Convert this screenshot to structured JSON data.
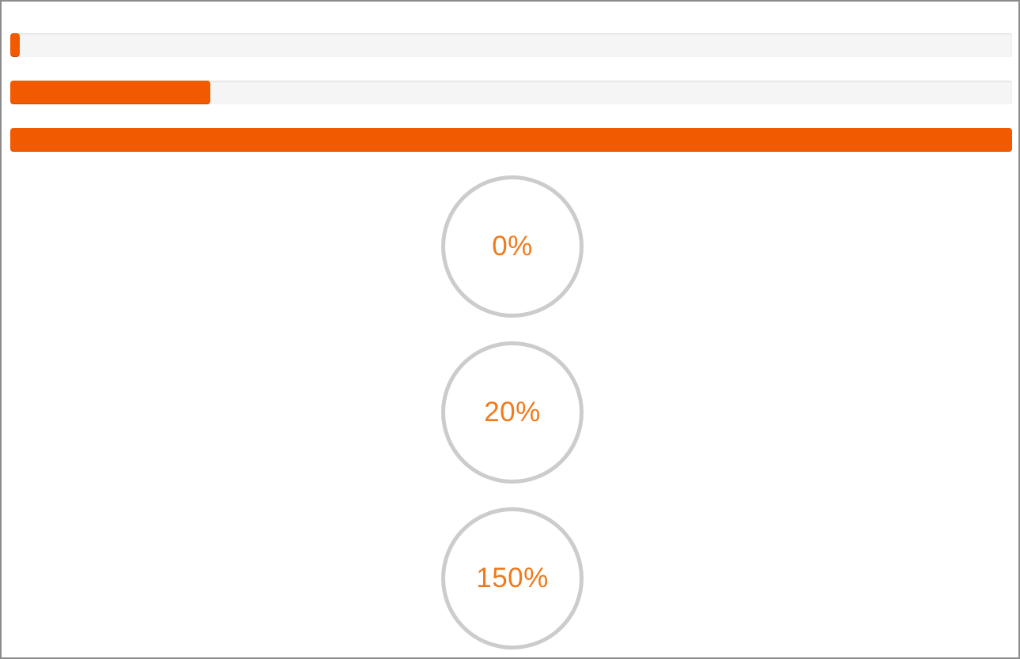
{
  "colors": {
    "accent": "#f25a00",
    "track": "#f5f5f5",
    "ring_border": "#cccccc",
    "ring_text": "#f07a1c",
    "frame_border": "#8c8c8c"
  },
  "progress_bars": [
    {
      "value_percent": 0
    },
    {
      "value_percent": 20
    },
    {
      "value_percent": 150
    }
  ],
  "progress_rings": [
    {
      "label": "0%"
    },
    {
      "label": "20%"
    },
    {
      "label": "150%"
    }
  ]
}
